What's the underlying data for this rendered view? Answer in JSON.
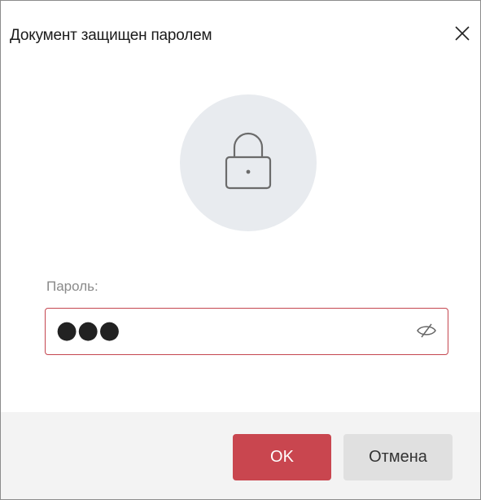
{
  "dialog": {
    "title": "Документ защищен паролем",
    "close_icon": "close-icon",
    "lock_icon": "lock-icon"
  },
  "password": {
    "label": "Пароль:",
    "masked_value": "●●●",
    "visibility_icon": "eye-slash-icon"
  },
  "buttons": {
    "ok_label": "OK",
    "cancel_label": "Отмена"
  },
  "colors": {
    "accent": "#c9464f",
    "lock_circle": "#e8ebef",
    "footer": "#f3f3f3",
    "cancel_button": "#e0e0e0"
  }
}
